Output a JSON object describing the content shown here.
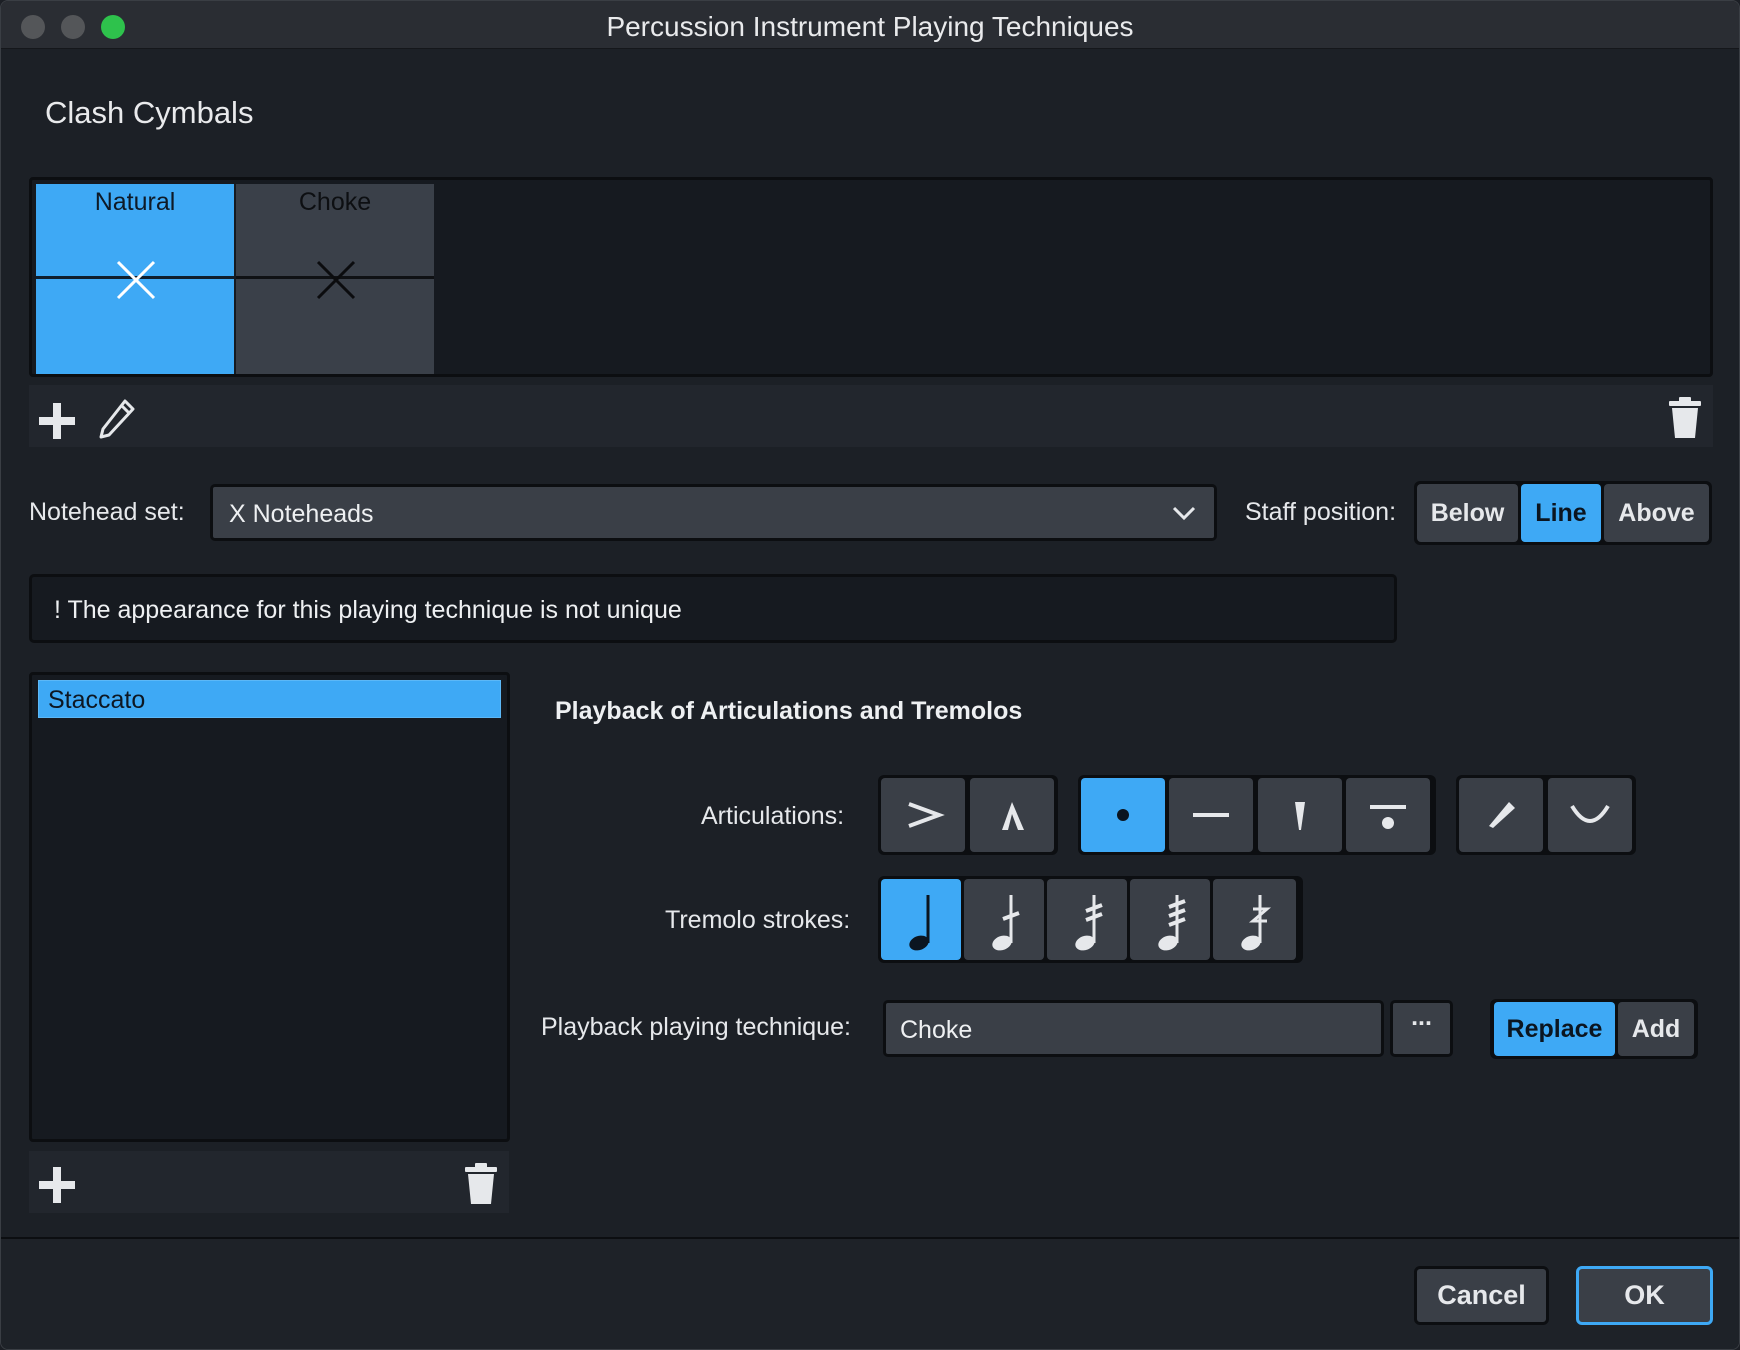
{
  "window": {
    "title": "Percussion Instrument Playing Techniques"
  },
  "instrument": {
    "name": "Clash Cymbals"
  },
  "techniques": [
    {
      "label": "Natural",
      "selected": true
    },
    {
      "label": "Choke",
      "selected": false
    }
  ],
  "tiles_toolbar": {
    "add_icon": "plus-icon",
    "edit_icon": "pencil-icon",
    "delete_icon": "trash-icon"
  },
  "notehead": {
    "label": "Notehead set:",
    "value": "X Noteheads"
  },
  "staff_position": {
    "label": "Staff position:",
    "options": [
      "Below",
      "Line",
      "Above"
    ],
    "selected": "Line"
  },
  "warning": {
    "text": "! The appearance for this playing technique is not unique"
  },
  "articulation_list": {
    "items": [
      "Staccato"
    ],
    "selected": "Staccato"
  },
  "playback": {
    "title": "Playback of Articulations and Tremolos",
    "articulations_label": "Articulations:",
    "articulations": [
      [
        "accent",
        "marcato"
      ],
      [
        "staccato",
        "tenuto",
        "staccatissimo",
        "staccato-tenuto"
      ],
      [
        "stress",
        "unstress"
      ]
    ],
    "articulations_selected": [
      "staccato"
    ],
    "tremolo_label": "Tremolo strokes:",
    "tremolos": [
      "no-stroke",
      "1-stroke",
      "2-strokes",
      "3-strokes",
      "buzz-roll"
    ],
    "tremolo_selected": "no-stroke",
    "technique_label": "Playback playing technique:",
    "technique_value": "Choke",
    "more_label": "...",
    "modes": [
      "Replace",
      "Add"
    ],
    "mode_selected": "Replace"
  },
  "footer": {
    "cancel": "Cancel",
    "ok": "OK"
  },
  "colors": {
    "accent": "#3ea9f5",
    "panel": "#161a20",
    "background": "#1c2026",
    "button": "#3a3f47"
  }
}
